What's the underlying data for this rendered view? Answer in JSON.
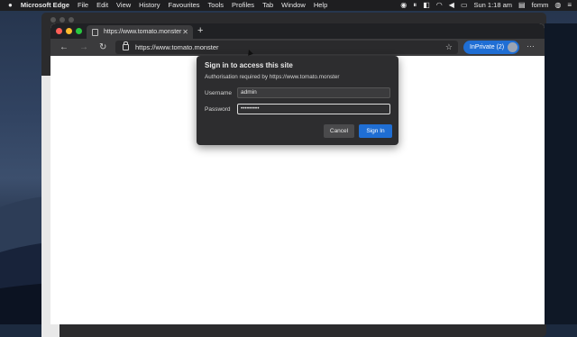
{
  "menubar": {
    "app_name": "Microsoft Edge",
    "items": [
      "File",
      "Edit",
      "View",
      "History",
      "Favourites",
      "Tools",
      "Profiles",
      "Tab",
      "Window",
      "Help"
    ],
    "clock": "Sun 1:18 am",
    "user": "fomm"
  },
  "tab": {
    "title": "https://www.tomato.monster",
    "close_glyph": "✕",
    "new_tab_glyph": "+"
  },
  "toolbar": {
    "back_glyph": "←",
    "forward_glyph": "→",
    "refresh_glyph": "↻",
    "url": "https://www.tomato.monster",
    "favorite_glyph": "☆",
    "inprivate_label": "InPrivate (2)",
    "more_glyph": "···"
  },
  "dialog": {
    "title": "Sign in to access this site",
    "subtitle": "Authorisation required by https://www.tomato.monster",
    "username_label": "Username",
    "username_value": "admin",
    "password_label": "Password",
    "password_value": "•••••••••",
    "cancel_label": "Cancel",
    "signin_label": "Sign In"
  },
  "colors": {
    "accent": "#1f6ed4",
    "traffic_red": "#ff5f57",
    "traffic_yellow": "#febc2e",
    "traffic_green": "#28c840"
  }
}
